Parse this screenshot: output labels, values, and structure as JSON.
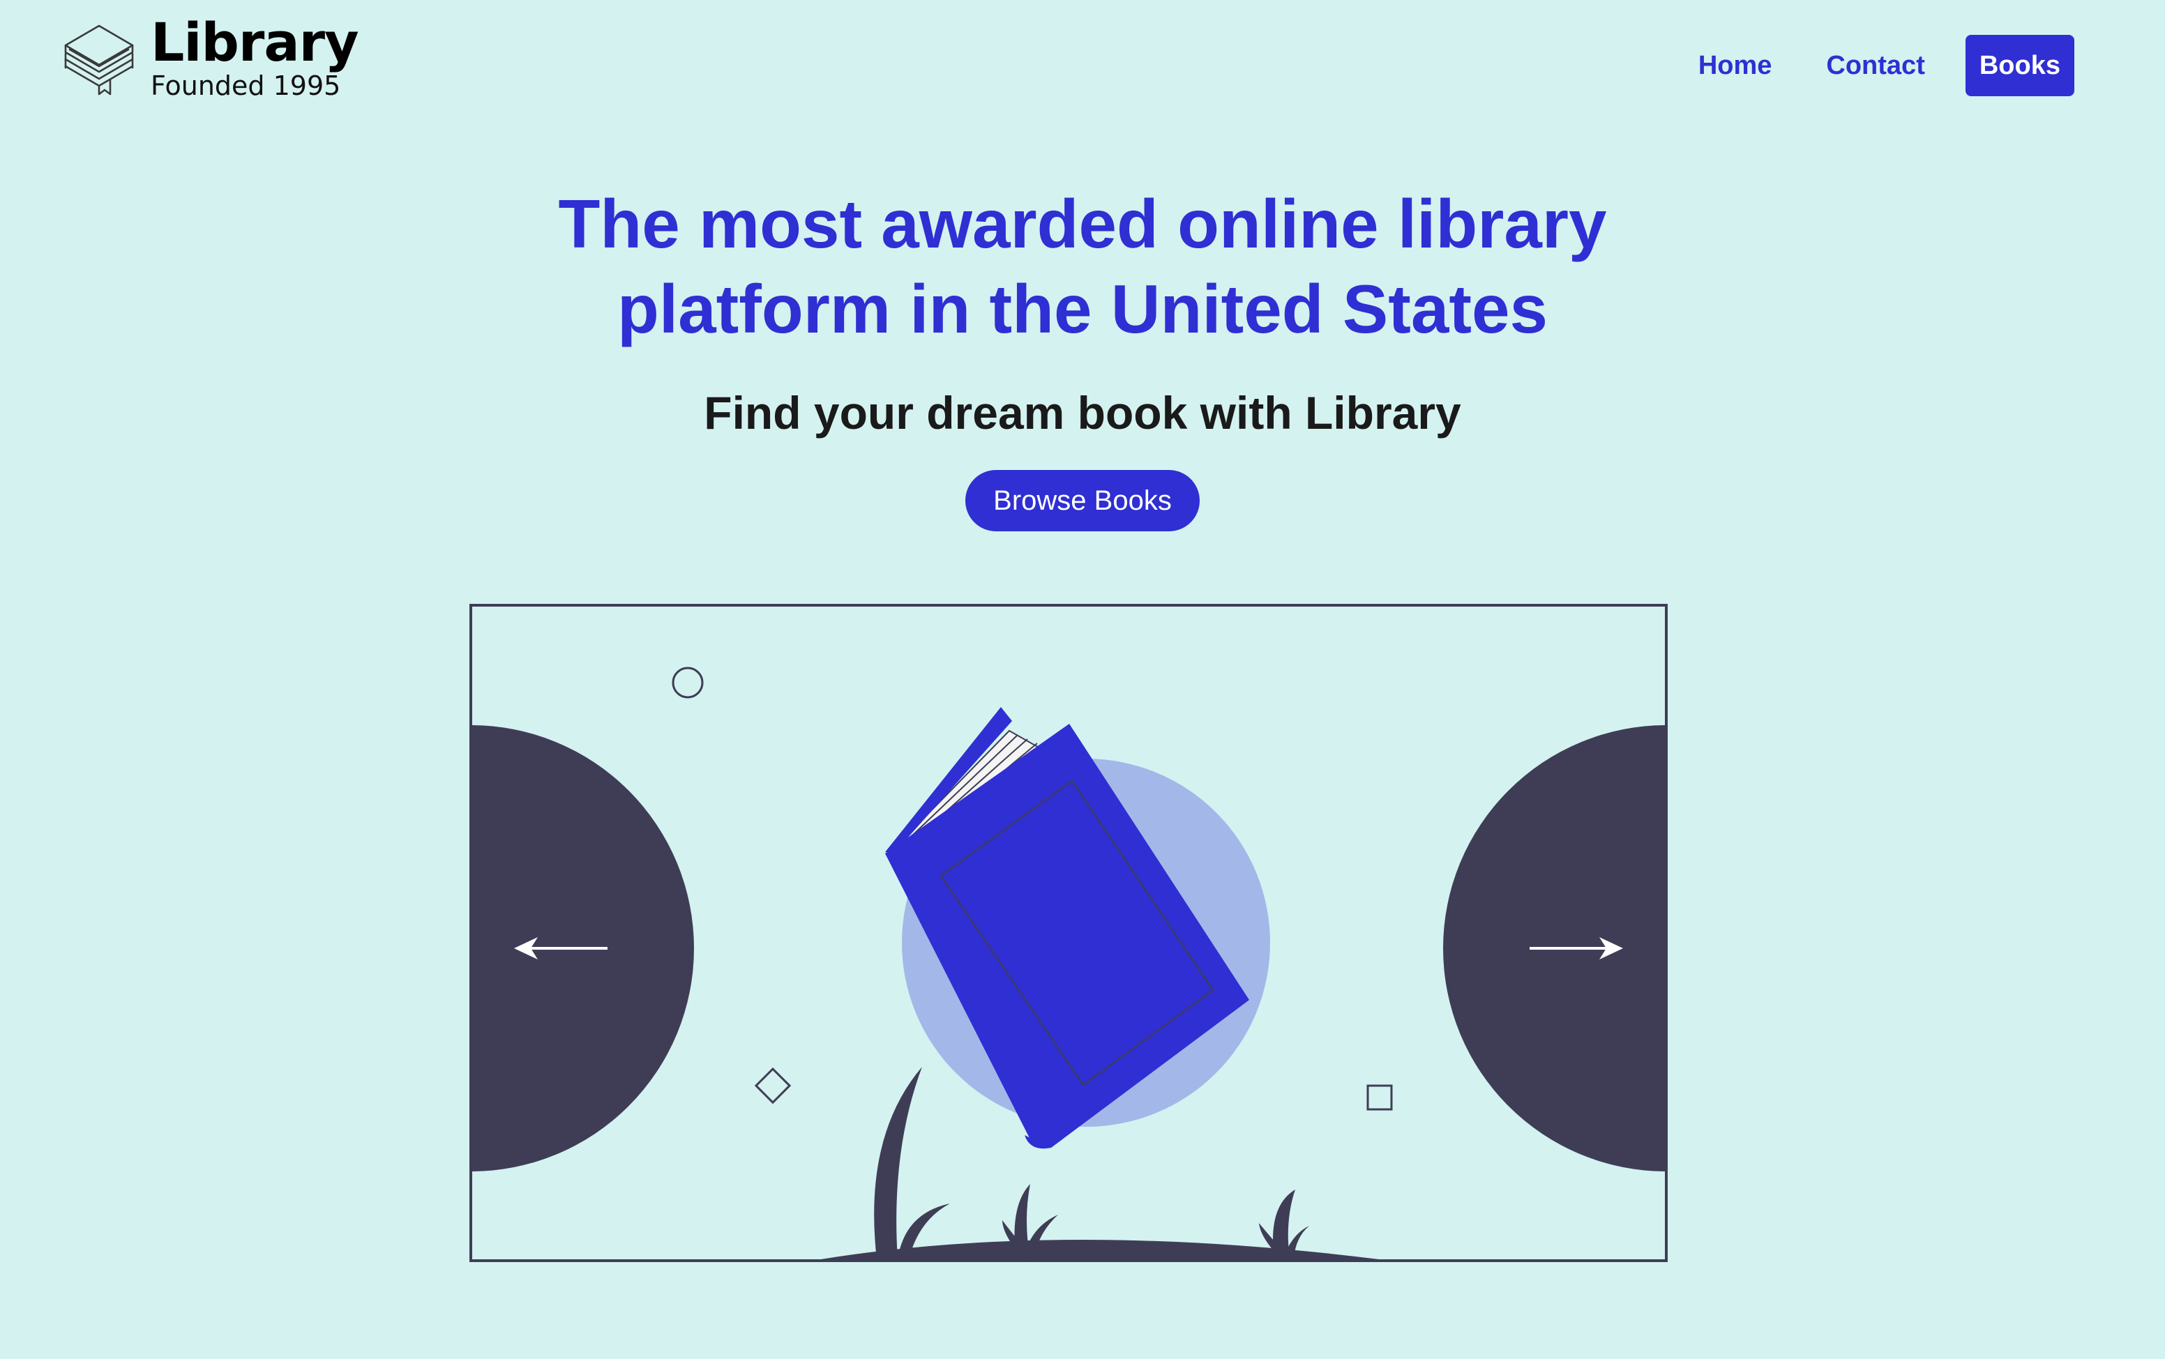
{
  "brand": {
    "name": "Library",
    "tagline": "Founded 1995",
    "icon": "stacked-books-icon"
  },
  "nav": {
    "items": [
      {
        "label": "Home",
        "active": false
      },
      {
        "label": "Contact",
        "active": false
      },
      {
        "label": "Books",
        "active": true
      }
    ]
  },
  "hero": {
    "title": "The most awarded online library platform in the United States",
    "subtitle": "Find your dream book with Library",
    "cta_label": "Browse Books"
  },
  "slider": {
    "prev_icon": "arrow-left-icon",
    "next_icon": "arrow-right-icon",
    "illustration": "book-illustration"
  },
  "colors": {
    "background": "#d4f2f0",
    "accent": "#2f2fd4",
    "dark": "#3f3d56",
    "circle": "#a3b8e8"
  }
}
